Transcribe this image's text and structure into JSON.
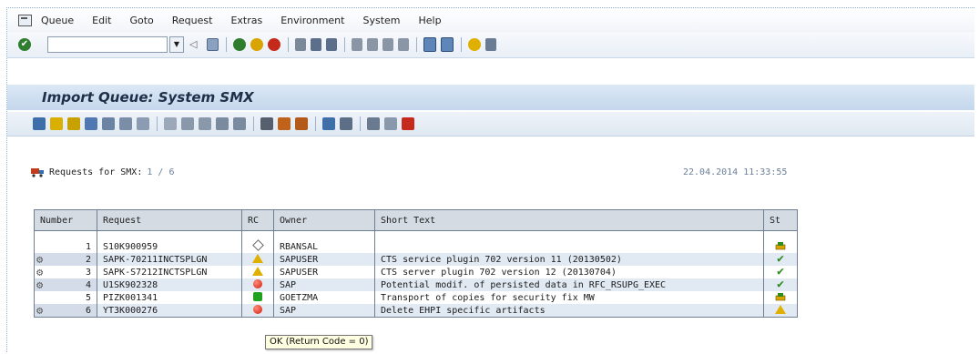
{
  "menubar": {
    "items": [
      "Queue",
      "Edit",
      "Goto",
      "Request",
      "Extras",
      "Environment",
      "System",
      "Help"
    ],
    "underline": [
      "Q",
      "E",
      "G",
      "R",
      "r",
      "v",
      "S",
      "H"
    ]
  },
  "toolbar": {
    "command_value": ""
  },
  "title": "Import Queue: System SMX",
  "requests_header": {
    "label": "Requests for SMX:",
    "count": "1 / 6",
    "datetime": "22.04.2014 11:33:55"
  },
  "table": {
    "columns": [
      "Number",
      "Request",
      "RC",
      "Owner",
      "Short Text",
      "St"
    ],
    "rows": [
      {
        "number": "1",
        "request": "S10K900959",
        "rc": "diamond",
        "owner": "RBANSAL",
        "short_text": "",
        "st": "stack-icon",
        "tool_icon": false
      },
      {
        "number": "2",
        "request": "SAPK-70211INCTSPLGN",
        "rc": "warning-triangle",
        "owner": "SAPUSER",
        "short_text": "CTS service plugin 702 version 11 (20130502)",
        "st": "check",
        "tool_icon": true
      },
      {
        "number": "3",
        "request": "SAPK-S7212INCTSPLGN",
        "rc": "warning-triangle",
        "owner": "SAPUSER",
        "short_text": "CTS server plugin 702 version 12 (20130704)",
        "st": "check",
        "tool_icon": true
      },
      {
        "number": "4",
        "request": "U1SK902328",
        "rc": "red-light",
        "owner": "SAP",
        "short_text": "Potential modif. of persisted data in RFC_RSUPG_EXEC",
        "st": "check",
        "tool_icon": true
      },
      {
        "number": "5",
        "request": "PIZK001341",
        "rc": "green-light",
        "owner": "GOETZMA",
        "short_text": "Transport of copies for security fix MW",
        "st": "stack-icon",
        "tool_icon": false
      },
      {
        "number": "6",
        "request": "YT3K000276",
        "rc": "red-light",
        "owner": "SAP",
        "short_text": "Delete EHPI specific artifacts",
        "st": "warning-triangle",
        "tool_icon": true
      }
    ]
  },
  "tooltip": "OK (Return Code = 0)",
  "colors": {
    "title_bg": "#c4d7ec",
    "header_bg": "#d4dbe3",
    "row_highlight": "#e1e9f3",
    "tooltip_bg": "#ffffe1"
  }
}
